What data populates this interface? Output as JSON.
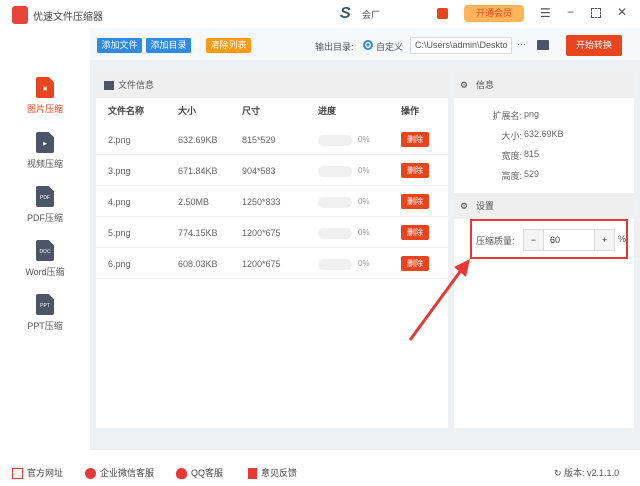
{
  "app": {
    "title": "优速文件压缩器",
    "brand_text": "会厂",
    "vip_label": "开通会员"
  },
  "toolbar": {
    "add_file": "添加文件",
    "add_dir": "添加目录",
    "clear_list": "清除列表",
    "output_label": "输出目录:",
    "custom_label": "自定义",
    "output_path": "C:\\Users\\admin\\Deskto",
    "more": "···",
    "start": "开始转换"
  },
  "sidebar": {
    "items": [
      {
        "label": "图片压缩",
        "icon": "image-file-icon",
        "active": true
      },
      {
        "label": "视频压缩",
        "icon": "video-file-icon",
        "badge": "▶"
      },
      {
        "label": "PDF压缩",
        "icon": "pdf-file-icon",
        "badge": "PDF"
      },
      {
        "label": "Word压缩",
        "icon": "doc-file-icon",
        "badge": "DOC"
      },
      {
        "label": "PPT压缩",
        "icon": "ppt-file-icon",
        "badge": "PPT"
      }
    ]
  },
  "filepanel": {
    "title": "文件信息",
    "columns": [
      "文件名称",
      "大小",
      "尺寸",
      "进度",
      "操作"
    ],
    "delete_label": "删除",
    "rows": [
      {
        "name": "2.png",
        "size": "632.69KB",
        "dims": "815*529",
        "progress": "0%"
      },
      {
        "name": "3.png",
        "size": "671.84KB",
        "dims": "904*583",
        "progress": "0%"
      },
      {
        "name": "4.png",
        "size": "2.50MB",
        "dims": "1250*833",
        "progress": "0%"
      },
      {
        "name": "5.png",
        "size": "774.15KB",
        "dims": "1200*675",
        "progress": "0%"
      },
      {
        "name": "6.png",
        "size": "608.03KB",
        "dims": "1200*675",
        "progress": "0%"
      }
    ]
  },
  "info": {
    "title": "信息",
    "fields": [
      {
        "k": "扩展名:",
        "v": "png"
      },
      {
        "k": "大小:",
        "v": "632.69KB"
      },
      {
        "k": "宽度:",
        "v": "815"
      },
      {
        "k": "高度:",
        "v": "529"
      }
    ]
  },
  "settings": {
    "title": "设置",
    "quality_label": "压缩质量:",
    "minus": "−",
    "value": "60",
    "plus": "+",
    "unit": "%"
  },
  "footer": {
    "website": "官方网址",
    "wechat": "企业微信客服",
    "qq": "QQ客服",
    "feedback": "意见反馈",
    "version": "版本: v2.1.1.0"
  },
  "colors": {
    "accent": "#e8441e",
    "blue": "#2f8ae5",
    "orange": "#ff9a16",
    "highlight": "#e53935"
  }
}
